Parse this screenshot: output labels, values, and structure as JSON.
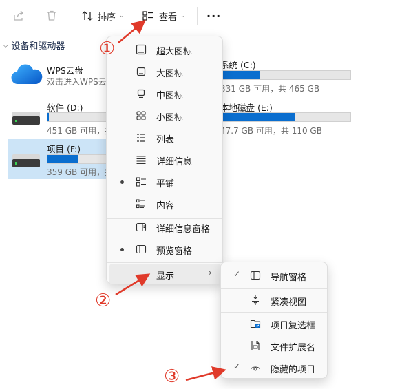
{
  "toolbar": {
    "sort_label": "排序",
    "view_label": "查看",
    "more_label": "···"
  },
  "section": {
    "title": "设备和驱动器"
  },
  "drives": [
    {
      "name": "WPS云盘",
      "subtitle": "双击进入WPS云",
      "fill": 0
    },
    {
      "name": "软件 (D:)",
      "subtitle": "451 GB 可用，共",
      "fill": 0.02
    },
    {
      "name": "项目 (F:)",
      "subtitle": "359 GB 可用，共",
      "fill": 0.55
    },
    {
      "name": "系统 (C:)",
      "subtitle": "331 GB 可用，共 465 GB",
      "fill": 0.29
    },
    {
      "name": "本地磁盘 (E:)",
      "subtitle": "47.7 GB 可用，共 110 GB",
      "fill": 0.57
    }
  ],
  "view_menu": {
    "items": [
      {
        "label": "超大图标",
        "icon": "extra-large-icons-icon",
        "selected": false
      },
      {
        "label": "大图标",
        "icon": "large-icons-icon",
        "selected": false
      },
      {
        "label": "中图标",
        "icon": "medium-icons-icon",
        "selected": false
      },
      {
        "label": "小图标",
        "icon": "small-icons-icon",
        "selected": false
      },
      {
        "label": "列表",
        "icon": "list-icon",
        "selected": false
      },
      {
        "label": "详细信息",
        "icon": "details-icon",
        "selected": false
      },
      {
        "label": "平铺",
        "icon": "tiles-icon",
        "selected": true
      },
      {
        "label": "内容",
        "icon": "content-icon",
        "selected": false
      }
    ],
    "pane_items": [
      {
        "label": "详细信息窗格",
        "icon": "details-pane-icon",
        "selected": false
      },
      {
        "label": "预览窗格",
        "icon": "preview-pane-icon",
        "selected": true
      }
    ],
    "show_label": "显示"
  },
  "show_menu": {
    "items": [
      {
        "label": "导航窗格",
        "icon": "navigation-pane-icon",
        "checked": true
      },
      {
        "label": "紧凑视图",
        "icon": "compact-view-icon",
        "checked": false
      },
      {
        "label": "项目复选框",
        "icon": "item-checkbox-icon",
        "checked": false
      },
      {
        "label": "文件扩展名",
        "icon": "file-extension-icon",
        "checked": false
      },
      {
        "label": "隐藏的项目",
        "icon": "hidden-items-icon",
        "checked": true
      }
    ]
  },
  "annotations": [
    "①",
    "②",
    "③"
  ],
  "colors": {
    "accent": "#0a6ecf",
    "arrow": "#e03a2a",
    "selection": "#cce4f7"
  }
}
